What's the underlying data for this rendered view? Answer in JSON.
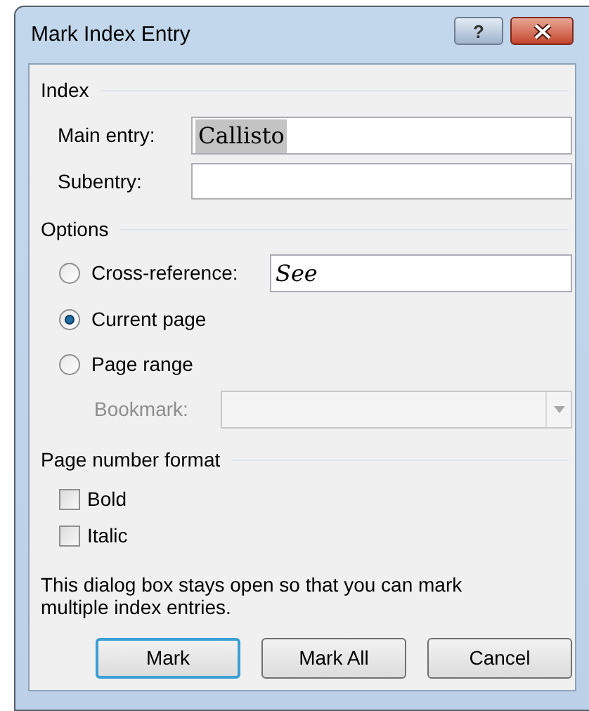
{
  "window": {
    "title": "Mark Index Entry"
  },
  "title_buttons": [
    {
      "kind": "help",
      "label": "?"
    },
    {
      "kind": "close"
    }
  ],
  "index": {
    "heading": "Index",
    "main_entry": {
      "label": "Main entry:",
      "value": "Callisto",
      "value_selected": true
    },
    "subentry": {
      "label": "Subentry:"
    }
  },
  "options": {
    "heading": "Options",
    "choices": [
      {
        "kind": "cross_reference",
        "label": "Cross-reference:",
        "selected": false,
        "value": "See"
      },
      {
        "kind": "current_page",
        "label": "Current page",
        "selected": true
      },
      {
        "kind": "page_range",
        "label": "Page range",
        "selected": false
      }
    ],
    "bookmark": {
      "label": "Bookmark:",
      "disabled": true
    }
  },
  "page_number_format": {
    "heading": "Page number format",
    "checkboxes": [
      {
        "label": "Bold",
        "checked": false
      },
      {
        "label": "Italic",
        "checked": false
      }
    ]
  },
  "note": "This dialog box stays open so that you can mark multiple index entries.",
  "buttons": [
    {
      "label": "Mark",
      "default": true
    },
    {
      "label": "Mark All",
      "default": false
    },
    {
      "label": "Cancel",
      "default": false
    }
  ]
}
